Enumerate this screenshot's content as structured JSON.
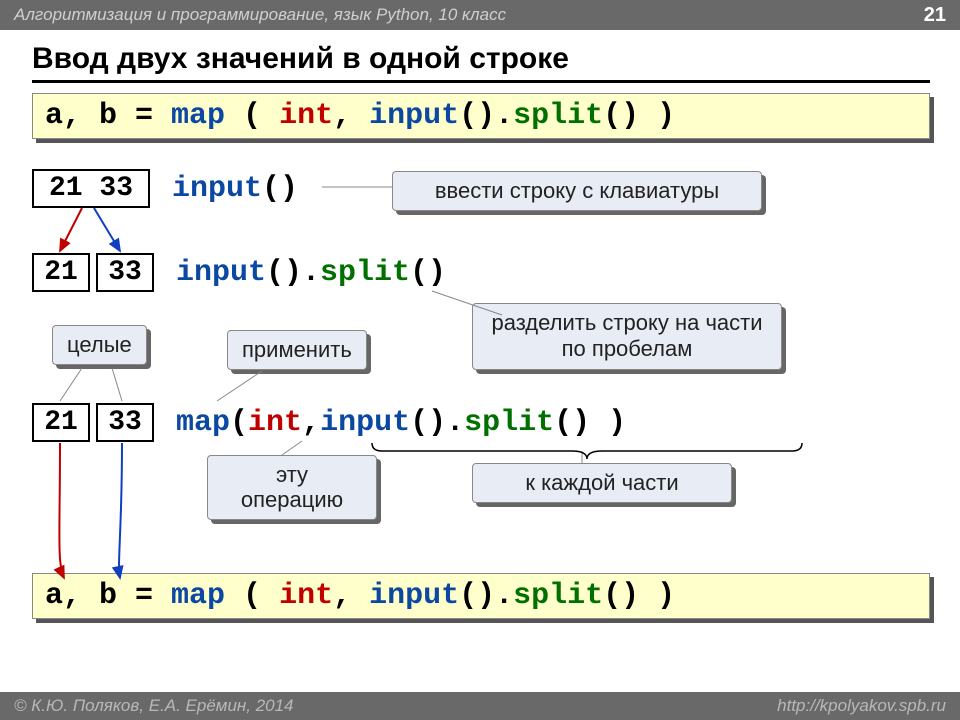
{
  "topbar": {
    "left": "Алгоритмизация и программирование, язык Python, 10 класс",
    "pagenum": "21"
  },
  "title": "Ввод двух значений в одной строке",
  "code_top": {
    "p1": "a, b = ",
    "p2": "map",
    "p3": " ( ",
    "p4": "int",
    "p5": ", ",
    "p6": "input",
    "p7": "().",
    "p8": "split",
    "p9": "() )"
  },
  "row1": {
    "box": "21 33",
    "code_a": "input",
    "code_b": "()"
  },
  "row2": {
    "box_a": "21",
    "box_b": "33",
    "code_a": "input",
    "code_b": "().",
    "code_c": "split",
    "code_d": "()"
  },
  "row3": {
    "box_a": "21",
    "box_b": "33",
    "p2": "map",
    "p3": " ( ",
    "p4": "int",
    "p5": ", ",
    "p6": "input",
    "p7": "().",
    "p8": "split",
    "p9": "() )"
  },
  "code_bottom": {
    "p1": "a, b = ",
    "p2": "map",
    "p3": " ( ",
    "p4": "int",
    "p5": ", ",
    "p6": "input",
    "p7": "().",
    "p8": "split",
    "p9": "() )"
  },
  "callouts": {
    "input_hint": "ввести строку с клавиатуры",
    "split_hint": "разделить строку на части по пробелам",
    "tselye": "целые",
    "apply": "применить",
    "this_op": "эту операцию",
    "to_each": "к каждой части"
  },
  "bottombar": {
    "left": "© К.Ю. Поляков, Е.А. Ерёмин, 2014",
    "right": "http://kpolyakov.spb.ru"
  }
}
